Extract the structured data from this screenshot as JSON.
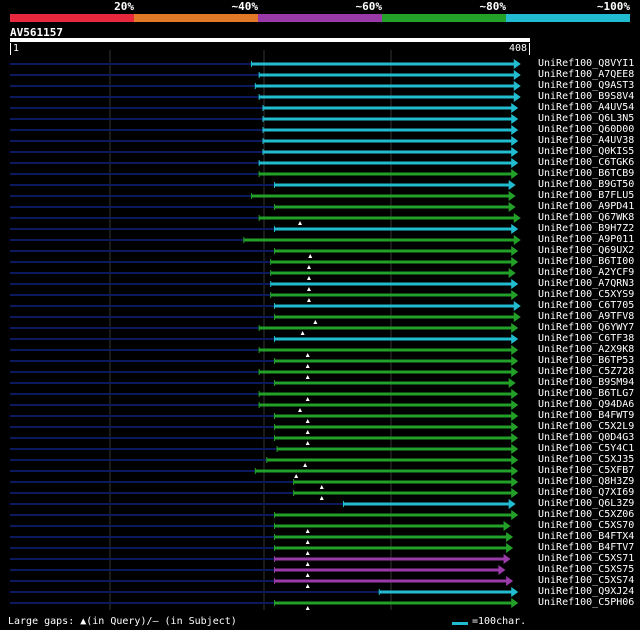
{
  "legend": [
    {
      "label": "20%",
      "color": "#e8283c"
    },
    {
      "label": "~40%",
      "color": "#e07a28"
    },
    {
      "label": "~60%",
      "color": "#9a3aa8"
    },
    {
      "label": "~80%",
      "color": "#22a028"
    },
    {
      "label": "~100%",
      "color": "#22bcd0"
    }
  ],
  "query": {
    "title": "AV561157",
    "start": "1",
    "end": "408"
  },
  "colors": {
    "cyan": "#22bcd0",
    "green": "#22a028",
    "purple": "#9a3aa8",
    "navy": "#0a1a5c",
    "grid": "#333333"
  },
  "hits": [
    {
      "label": "UniRef100_Q8VYI1",
      "c": "cyan",
      "s": 190,
      "e": 400,
      "m": null
    },
    {
      "label": "UniRef100_A7QEE8",
      "c": "cyan",
      "s": 196,
      "e": 400,
      "m": null
    },
    {
      "label": "UniRef100_Q9AST3",
      "c": "cyan",
      "s": 193,
      "e": 400,
      "m": null
    },
    {
      "label": "UniRef100_B9S8V4",
      "c": "cyan",
      "s": 196,
      "e": 400,
      "m": null
    },
    {
      "label": "UniRef100_A4UV54",
      "c": "cyan",
      "s": 199,
      "e": 398,
      "m": null
    },
    {
      "label": "UniRef100_Q6L3N5",
      "c": "cyan",
      "s": 199,
      "e": 398,
      "m": null
    },
    {
      "label": "UniRef100_Q60D00",
      "c": "cyan",
      "s": 199,
      "e": 398,
      "m": null
    },
    {
      "label": "UniRef100_A4UV38",
      "c": "cyan",
      "s": 199,
      "e": 398,
      "m": null
    },
    {
      "label": "UniRef100_Q0KIS5",
      "c": "cyan",
      "s": 199,
      "e": 398,
      "m": null
    },
    {
      "label": "UniRef100_C6TGK6",
      "c": "cyan",
      "s": 196,
      "e": 398,
      "m": null
    },
    {
      "label": "UniRef100_B6TCB9",
      "c": "green",
      "s": 196,
      "e": 398,
      "m": null
    },
    {
      "label": "UniRef100_B9GT50",
      "c": "cyan",
      "s": 208,
      "e": 396,
      "m": null
    },
    {
      "label": "UniRef100_B7FLU5",
      "c": "green",
      "s": 190,
      "e": 396,
      "m": null
    },
    {
      "label": "UniRef100_A9PD41",
      "c": "green",
      "s": 208,
      "e": 396,
      "m": null
    },
    {
      "label": "UniRef100_Q67WK8",
      "c": "green",
      "s": 196,
      "e": 400,
      "m": 228
    },
    {
      "label": "UniRef100_B9H7Z2",
      "c": "cyan",
      "s": 208,
      "e": 398,
      "m": null
    },
    {
      "label": "UniRef100_A9P011",
      "c": "green",
      "s": 184,
      "e": 400,
      "m": null
    },
    {
      "label": "UniRef100_Q69UX2",
      "c": "green",
      "s": 208,
      "e": 398,
      "m": 236
    },
    {
      "label": "UniRef100_B6TI00",
      "c": "green",
      "s": 205,
      "e": 398,
      "m": 235
    },
    {
      "label": "UniRef100_A2YCF9",
      "c": "green",
      "s": 205,
      "e": 396,
      "m": 235
    },
    {
      "label": "UniRef100_A7QRN3",
      "c": "cyan",
      "s": 205,
      "e": 398,
      "m": 235
    },
    {
      "label": "UniRef100_C5XYS9",
      "c": "green",
      "s": 205,
      "e": 398,
      "m": 235
    },
    {
      "label": "UniRef100_C6T705",
      "c": "cyan",
      "s": 208,
      "e": 400,
      "m": null
    },
    {
      "label": "UniRef100_A9TFV8",
      "c": "green",
      "s": 208,
      "e": 400,
      "m": 240
    },
    {
      "label": "UniRef100_Q6YWY7",
      "c": "green",
      "s": 196,
      "e": 398,
      "m": 230
    },
    {
      "label": "UniRef100_C6TF38",
      "c": "cyan",
      "s": 208,
      "e": 398,
      "m": null
    },
    {
      "label": "UniRef100_A2X9K8",
      "c": "green",
      "s": 196,
      "e": 398,
      "m": 234
    },
    {
      "label": "UniRef100_B6TP53",
      "c": "green",
      "s": 208,
      "e": 398,
      "m": 234
    },
    {
      "label": "UniRef100_C5Z728",
      "c": "green",
      "s": 196,
      "e": 398,
      "m": 234
    },
    {
      "label": "UniRef100_B9SM94",
      "c": "green",
      "s": 208,
      "e": 396,
      "m": null
    },
    {
      "label": "UniRef100_B6TLG7",
      "c": "green",
      "s": 196,
      "e": 398,
      "m": 234
    },
    {
      "label": "UniRef100_Q94DA6",
      "c": "green",
      "s": 196,
      "e": 398,
      "m": 228
    },
    {
      "label": "UniRef100_B4FWT9",
      "c": "green",
      "s": 208,
      "e": 398,
      "m": 234
    },
    {
      "label": "UniRef100_C5X2L9",
      "c": "green",
      "s": 208,
      "e": 398,
      "m": 234
    },
    {
      "label": "UniRef100_Q0D4G3",
      "c": "green",
      "s": 208,
      "e": 398,
      "m": 234
    },
    {
      "label": "UniRef100_C5Y4C1",
      "c": "green",
      "s": 210,
      "e": 398,
      "m": null
    },
    {
      "label": "UniRef100_C5XJ35",
      "c": "green",
      "s": 202,
      "e": 398,
      "m": 232
    },
    {
      "label": "UniRef100_C5XFB7",
      "c": "green",
      "s": 193,
      "e": 398,
      "m": 225
    },
    {
      "label": "UniRef100_Q8H3Z9",
      "c": "green",
      "s": 223,
      "e": 398,
      "m": 245
    },
    {
      "label": "UniRef100_Q7XI69",
      "c": "green",
      "s": 223,
      "e": 398,
      "m": 245
    },
    {
      "label": "UniRef100_Q6L3Z9",
      "c": "cyan",
      "s": 262,
      "e": 396,
      "m": null
    },
    {
      "label": "UniRef100_C5XZ06",
      "c": "green",
      "s": 208,
      "e": 398,
      "m": null
    },
    {
      "label": "UniRef100_C5XS70",
      "c": "green",
      "s": 208,
      "e": 392,
      "m": 234
    },
    {
      "label": "UniRef100_B4FTX4",
      "c": "green",
      "s": 208,
      "e": 394,
      "m": 234
    },
    {
      "label": "UniRef100_B4FTV7",
      "c": "green",
      "s": 208,
      "e": 394,
      "m": 234
    },
    {
      "label": "UniRef100_C5XS71",
      "c": "purple",
      "s": 208,
      "e": 392,
      "m": 234
    },
    {
      "label": "UniRef100_C5XS75",
      "c": "purple",
      "s": 208,
      "e": 388,
      "m": 234
    },
    {
      "label": "UniRef100_C5XS74",
      "c": "purple",
      "s": 208,
      "e": 394,
      "m": 234
    },
    {
      "label": "UniRef100_Q9XJ24",
      "c": "cyan",
      "s": 290,
      "e": 398,
      "m": null
    },
    {
      "label": "UniRef100_C5PH06",
      "c": "green",
      "s": 208,
      "e": 398,
      "m": 234
    }
  ],
  "footer": {
    "text": "Large gaps: ▲(in Query)/— (in Subject)",
    "scale": "=100char."
  }
}
